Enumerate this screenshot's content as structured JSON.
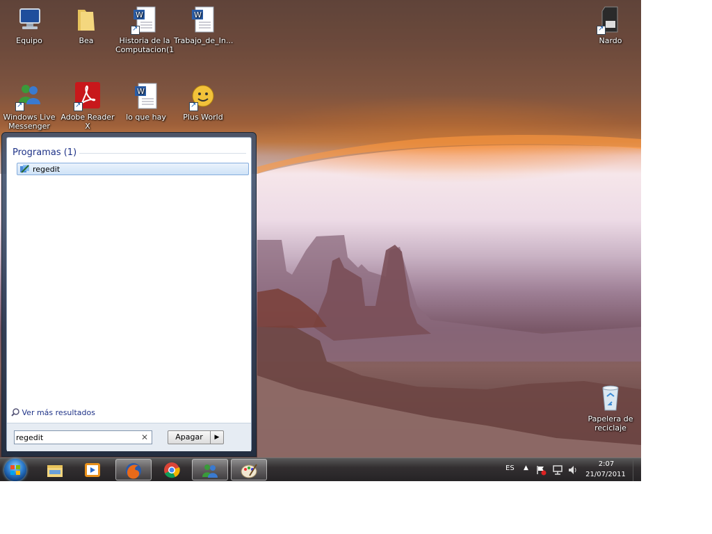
{
  "desktop": {
    "icons": [
      {
        "label": "Equipo",
        "icon": "computer-icon"
      },
      {
        "label": "Bea",
        "icon": "folder-icon"
      },
      {
        "label": "Historia de la Computacion(1",
        "icon": "word-document-icon"
      },
      {
        "label": "Trabajo_de_In...",
        "icon": "word-document-icon"
      },
      {
        "label": "Nardo",
        "icon": "sd-card-icon"
      },
      {
        "label": "Windows Live Messenger",
        "icon": "messenger-icon"
      },
      {
        "label": "Adobe Reader X",
        "icon": "adobe-reader-icon"
      },
      {
        "label": "lo que hay",
        "icon": "word-document-icon"
      },
      {
        "label": "Plus World",
        "icon": "plus-world-icon"
      },
      {
        "label": "Papelera de reciclaje",
        "icon": "recycle-bin-icon"
      }
    ]
  },
  "start_menu": {
    "section_title": "Programas (1)",
    "result_label": "regedit",
    "more_results": "Ver más resultados",
    "search_value": "regedit",
    "shutdown_label": "Apagar"
  },
  "taskbar": {
    "pinned": [
      "explorer-icon",
      "media-player-icon",
      "firefox-icon",
      "chrome-icon",
      "messenger-icon",
      "paint-icon"
    ],
    "language": "ES",
    "time": "2:07",
    "date": "21/07/2011"
  },
  "colors": {
    "accent": "#1e3287",
    "selection": "#cfe3f7"
  }
}
